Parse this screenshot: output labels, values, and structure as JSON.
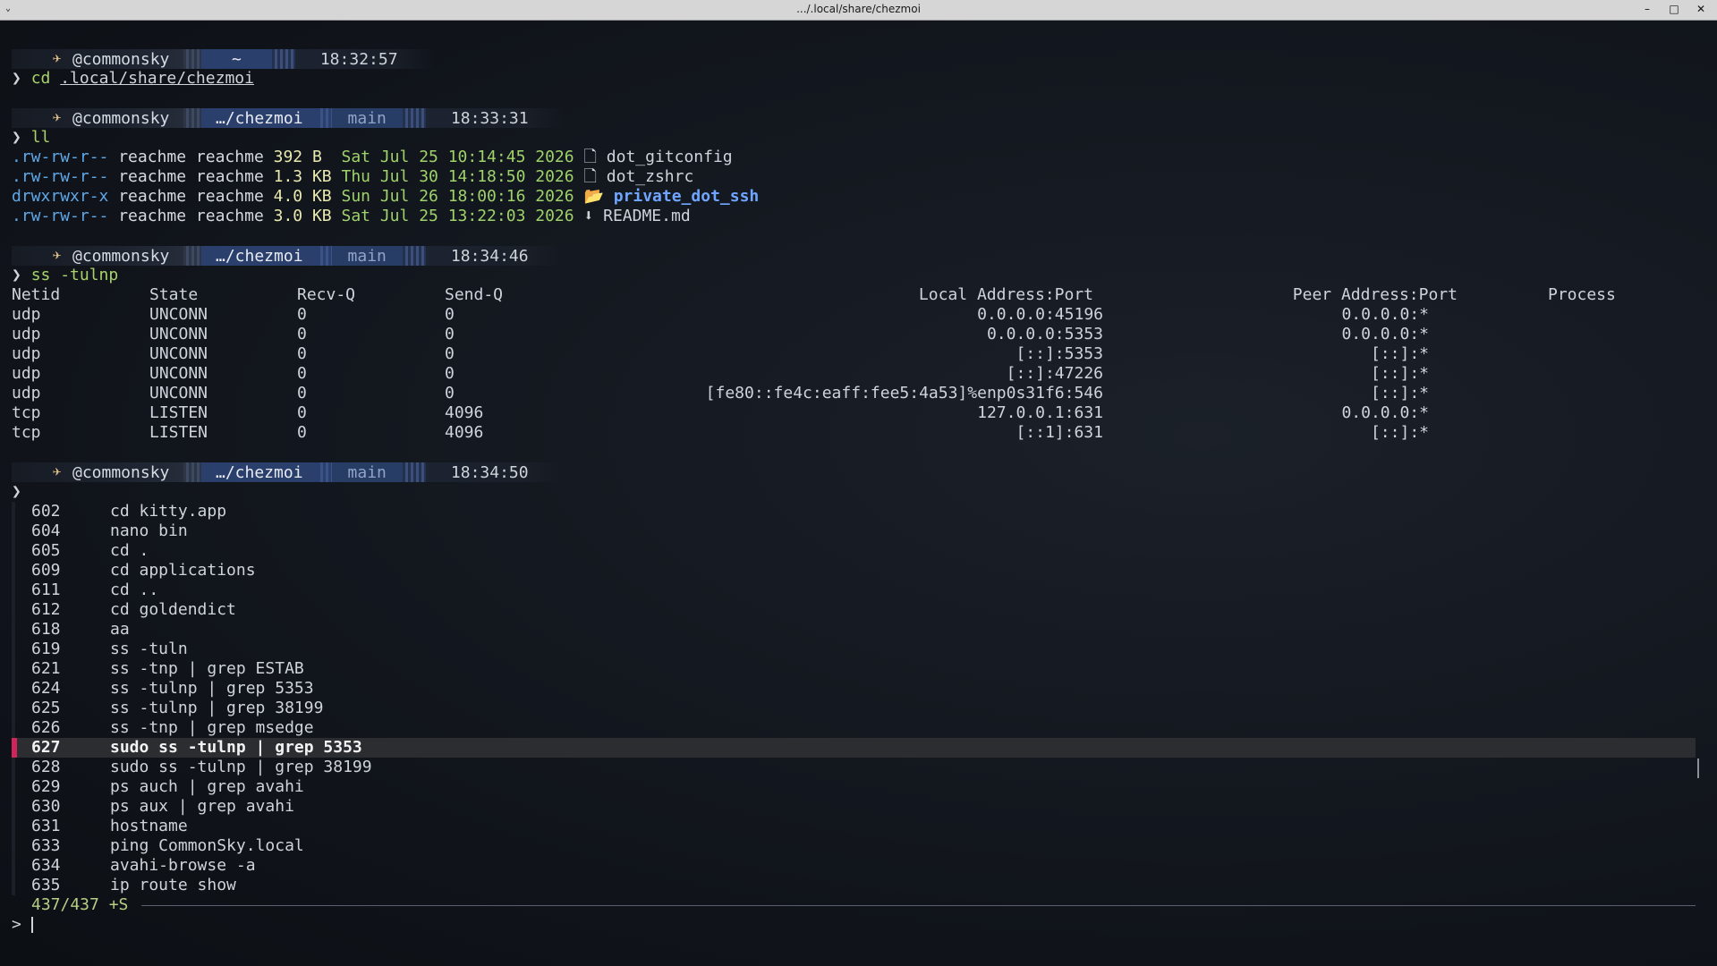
{
  "window": {
    "title": ".../.local/share/chezmoi",
    "min": "–",
    "max": "□",
    "close": "✕",
    "menu": "⌄"
  },
  "prompts": [
    {
      "user": "@commonsky",
      "dir": "~",
      "branch": "",
      "time": "18:32:57",
      "cmd": "cd",
      "arg": ".local/share/chezmoi"
    },
    {
      "user": "@commonsky",
      "dir": "…/chezmoi",
      "branch": "main",
      "time": "18:33:31",
      "cmd": "ll",
      "arg": ""
    },
    {
      "user": "@commonsky",
      "dir": "…/chezmoi",
      "branch": "main",
      "time": "18:34:46",
      "cmd": "ss -tulnp",
      "arg": ""
    },
    {
      "user": "@commonsky",
      "dir": "…/chezmoi",
      "branch": "main",
      "time": "18:34:50",
      "cmd": "",
      "arg": ""
    }
  ],
  "listing": [
    {
      "perm": ".rw-rw-r--",
      "user": "reachme",
      "group": "reachme",
      "size": "392 B",
      "date": "Sat Jul 25 10:14:45 2026",
      "icon": "file-icon",
      "glyph": "🗋",
      "name": "dot_gitconfig"
    },
    {
      "perm": ".rw-rw-r--",
      "user": "reachme",
      "group": "reachme",
      "size": "1.3 KB",
      "date": "Thu Jul 30 14:18:50 2026",
      "icon": "file-icon",
      "glyph": "🗋",
      "name": "dot_zshrc"
    },
    {
      "perm": "drwxrwxr-x",
      "user": "reachme",
      "group": "reachme",
      "size": "4.0 KB",
      "date": "Sun Jul 26 18:00:16 2026",
      "icon": "folder-icon",
      "glyph": "📂",
      "name": "private_dot_ssh"
    },
    {
      "perm": ".rw-rw-r--",
      "user": "reachme",
      "group": "reachme",
      "size": "3.0 KB",
      "date": "Sat Jul 25 13:22:03 2026",
      "icon": "download-icon",
      "glyph": "⬇",
      "name": "README.md"
    }
  ],
  "ss": {
    "headers": [
      "Netid",
      "State",
      "Recv-Q",
      "Send-Q",
      "Local Address:Port",
      "Peer Address:Port",
      "Process"
    ],
    "rows": [
      [
        "udp",
        "UNCONN",
        "0",
        "0",
        "0.0.0.0:45196",
        "0.0.0.0:*",
        ""
      ],
      [
        "udp",
        "UNCONN",
        "0",
        "0",
        "0.0.0.0:5353",
        "0.0.0.0:*",
        ""
      ],
      [
        "udp",
        "UNCONN",
        "0",
        "0",
        "[::]:5353",
        "[::]:*",
        ""
      ],
      [
        "udp",
        "UNCONN",
        "0",
        "0",
        "[::]:47226",
        "[::]:*",
        ""
      ],
      [
        "udp",
        "UNCONN",
        "0",
        "0",
        "[fe80::fe4c:eaff:fee5:4a53]%enp0s31f6:546",
        "[::]:*",
        ""
      ],
      [
        "tcp",
        "LISTEN",
        "0",
        "4096",
        "127.0.0.1:631",
        "0.0.0.0:*",
        ""
      ],
      [
        "tcp",
        "LISTEN",
        "0",
        "4096",
        "[::1]:631",
        "[::]:*",
        ""
      ]
    ]
  },
  "history": {
    "items": [
      {
        "num": "602",
        "cmd": "cd kitty.app"
      },
      {
        "num": "604",
        "cmd": "nano bin"
      },
      {
        "num": "605",
        "cmd": "cd ."
      },
      {
        "num": "609",
        "cmd": "cd applications"
      },
      {
        "num": "611",
        "cmd": "cd .."
      },
      {
        "num": "612",
        "cmd": "cd goldendict"
      },
      {
        "num": "618",
        "cmd": "aa"
      },
      {
        "num": "619",
        "cmd": "ss -tuln"
      },
      {
        "num": "621",
        "cmd": "ss -tnp | grep ESTAB"
      },
      {
        "num": "624",
        "cmd": "ss -tulnp | grep 5353"
      },
      {
        "num": "625",
        "cmd": "ss -tulnp | grep 38199"
      },
      {
        "num": "626",
        "cmd": "ss -tnp | grep msedge"
      },
      {
        "num": "627",
        "cmd": "sudo ss -tulnp | grep 5353"
      },
      {
        "num": "628",
        "cmd": "sudo ss -tulnp | grep 38199"
      },
      {
        "num": "629",
        "cmd": "ps auch | grep avahi"
      },
      {
        "num": "630",
        "cmd": "ps aux | grep avahi"
      },
      {
        "num": "631",
        "cmd": "hostname"
      },
      {
        "num": "633",
        "cmd": "ping CommonSky.local"
      },
      {
        "num": "634",
        "cmd": "avahi-browse -a"
      },
      {
        "num": "635",
        "cmd": "ip route show"
      }
    ],
    "selected_index": 12,
    "counter": "437/437 +S",
    "prompt_symbol": ">"
  },
  "prompt_arrow": "❯"
}
